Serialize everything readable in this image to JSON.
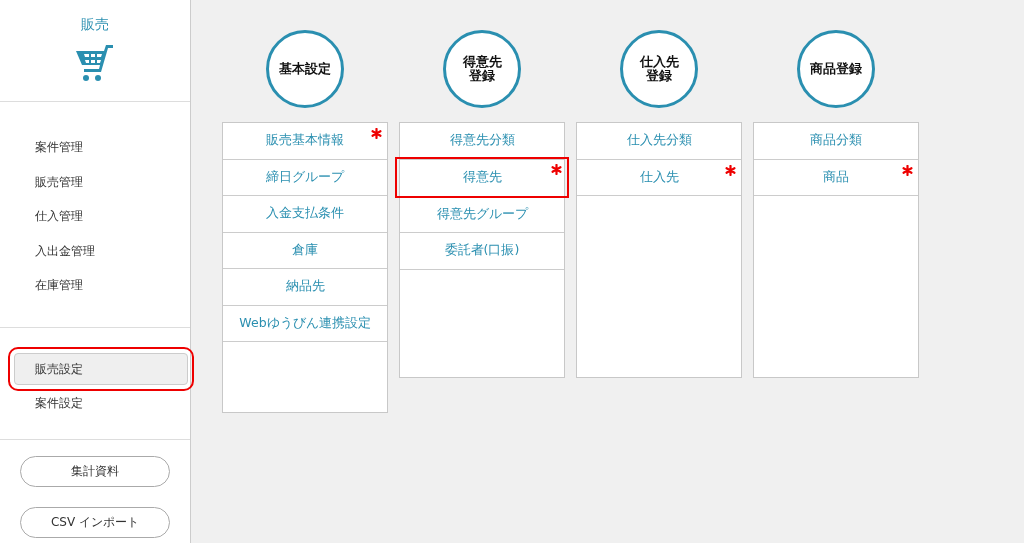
{
  "sidebar": {
    "title": "販売",
    "menu": [
      {
        "label": "案件管理"
      },
      {
        "label": "販売管理"
      },
      {
        "label": "仕入管理"
      },
      {
        "label": "入出金管理"
      },
      {
        "label": "在庫管理"
      }
    ],
    "settings": [
      {
        "label": "販売設定",
        "selected": true,
        "highlighted": true
      },
      {
        "label": "案件設定",
        "selected": false,
        "highlighted": false
      }
    ],
    "buttons": [
      "集計資料",
      "CSV インポート"
    ]
  },
  "categories": [
    {
      "title": [
        "基本設定"
      ],
      "items": [
        {
          "label": "販売基本情報",
          "required": true,
          "highlighted": false
        },
        {
          "label": "締日グループ",
          "required": false,
          "highlighted": false
        },
        {
          "label": "入金支払条件",
          "required": false,
          "highlighted": false
        },
        {
          "label": "倉庫",
          "required": false,
          "highlighted": false
        },
        {
          "label": "納品先",
          "required": false,
          "highlighted": false
        },
        {
          "label": "Webゆうびん連携設定",
          "required": false,
          "highlighted": false
        }
      ]
    },
    {
      "title": [
        "得意先",
        "登録"
      ],
      "items": [
        {
          "label": "得意先分類",
          "required": false,
          "highlighted": false
        },
        {
          "label": "得意先",
          "required": true,
          "highlighted": true
        },
        {
          "label": "得意先グループ",
          "required": false,
          "highlighted": false
        },
        {
          "label": "委託者(口振)",
          "required": false,
          "highlighted": false
        }
      ]
    },
    {
      "title": [
        "仕入先",
        "登録"
      ],
      "items": [
        {
          "label": "仕入先分類",
          "required": false,
          "highlighted": false
        },
        {
          "label": "仕入先",
          "required": true,
          "highlighted": false
        }
      ]
    },
    {
      "title": [
        "商品登録"
      ],
      "items": [
        {
          "label": "商品分類",
          "required": false,
          "highlighted": false
        },
        {
          "label": "商品",
          "required": true,
          "highlighted": false
        }
      ]
    }
  ]
}
